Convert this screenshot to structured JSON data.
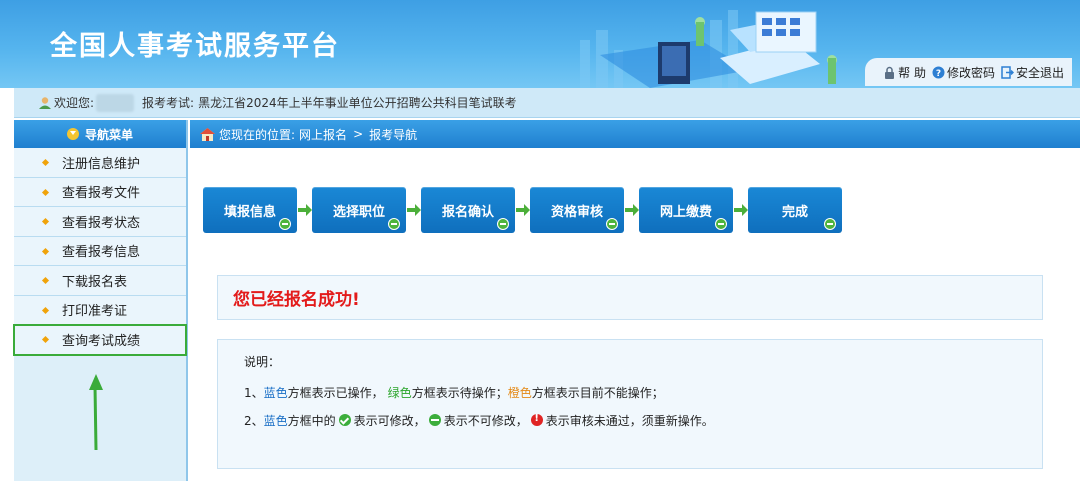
{
  "header": {
    "site_title": "全国人事考试服务平台",
    "links": [
      {
        "label": "帮 助",
        "icon": "lock-icon"
      },
      {
        "label": "修改密码",
        "icon": "help-icon"
      },
      {
        "label": "安全退出",
        "icon": "logout-icon"
      }
    ]
  },
  "welcome": {
    "greeting": "欢迎您:",
    "exam_label": "报考考试:",
    "exam_name": "黑龙江省2024年上半年事业单位公开招聘公共科目笔试联考"
  },
  "sidebar": {
    "title": "导航菜单",
    "items": [
      {
        "label": "注册信息维护"
      },
      {
        "label": "查看报考文件"
      },
      {
        "label": "查看报考状态"
      },
      {
        "label": "查看报考信息"
      },
      {
        "label": "下载报名表"
      },
      {
        "label": "打印准考证"
      },
      {
        "label": "查询考试成绩"
      }
    ]
  },
  "breadcrumb": {
    "prefix": "您现在的位置:",
    "crumbs": [
      "网上报名",
      "报考导航"
    ],
    "separator": ">"
  },
  "steps": [
    {
      "label": "填报信息"
    },
    {
      "label": "选择职位"
    },
    {
      "label": "报名确认"
    },
    {
      "label": "资格审核"
    },
    {
      "label": "网上缴费"
    },
    {
      "label": "完成"
    }
  ],
  "success_message": "您已经报名成功!",
  "notes": {
    "title": "说明：",
    "line1": {
      "num": "1、",
      "blue": "蓝色",
      "t1": "方框表示已操作，",
      "green": "绿色",
      "t2": "方框表示待操作；",
      "orange": "橙色",
      "t3": "方框表示目前不能操作；"
    },
    "line2": {
      "num": "2、",
      "blue": "蓝色",
      "t1": "方框中的",
      "t2": "表示可修改，",
      "t3": "表示不可修改，",
      "t4": "表示审核未通过，须重新操作。"
    }
  },
  "colors": {
    "header_blue": "#3e9fe4",
    "nav_blue": "#1f7fcf",
    "step_blue": "#0f6fbd",
    "success_red": "#e31b1b",
    "highlight_green": "#3aab3a"
  }
}
